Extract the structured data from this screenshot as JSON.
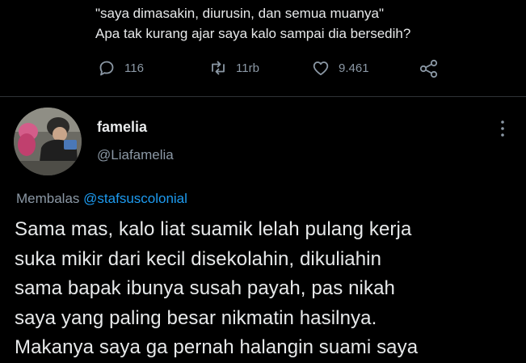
{
  "quoted": {
    "line1": "\"saya dimasakin, diurusin, dan semua muanya\"",
    "line2": "Apa tak kurang ajar saya kalo sampai dia bersedih?"
  },
  "actions": {
    "reply_icon": "reply-bubble-icon",
    "reply_count": "116",
    "retweet_icon": "retweet-icon",
    "retweet_count": "11rb",
    "like_icon": "heart-icon",
    "like_count": "9.461",
    "share_icon": "share-icon"
  },
  "author": {
    "display_name": "famelia",
    "handle": "@Liafamelia",
    "more_icon": "more-vertical-icon"
  },
  "reply_to": {
    "prefix": "Membalas",
    "mention": "@stafsuscolonial"
  },
  "tweet": {
    "lines": [
      "Sama mas, kalo liat suamik lelah pulang kerja",
      "suka mikir dari kecil disekolahin, dikuliahin",
      "sama bapak ibunya susah payah, pas nikah",
      "saya yang paling besar nikmatin hasilnya.",
      "Makanya saya ga pernah halangin suami saya"
    ]
  },
  "colors": {
    "background": "#000000",
    "text": "#e7e9ea",
    "muted": "#8b98a5",
    "link": "#1d9bf0",
    "divider": "#2f3336"
  }
}
